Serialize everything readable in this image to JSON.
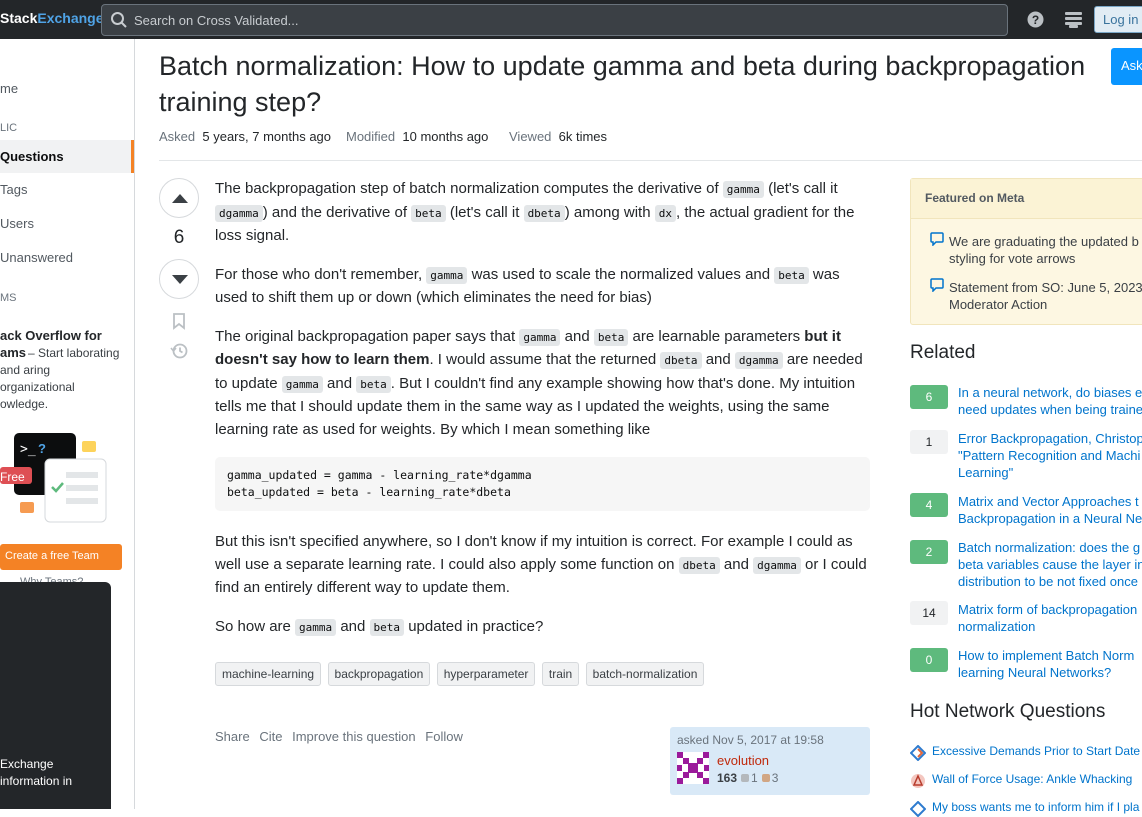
{
  "header": {
    "logo_stack": "Stack",
    "logo_exchange": "Exchange",
    "search_placeholder": "Search on Cross Validated...",
    "login_label": "Log in"
  },
  "leftnav": {
    "home": "me",
    "public_label": "LIC",
    "questions": "Questions",
    "tags": "Tags",
    "users": "Users",
    "unanswered": "Unanswered",
    "teams_label": "MS",
    "teams_title": "ack Overflow for ams",
    "teams_desc": "– Start laborating and aring organizational owledge.",
    "free_badge": "Free",
    "create_team": "Create a free Team",
    "why_teams": "Why Teams?",
    "panel_text": "Exchange information in"
  },
  "question": {
    "title": "Batch normalization: How to update gamma and beta during backpropagation training step?",
    "ask_label": "Ask",
    "asked_label": "Asked",
    "asked_value": "5 years, 7 months ago",
    "modified_label": "Modified",
    "modified_value": "10 months ago",
    "viewed_label": "Viewed",
    "viewed_value": "6k times",
    "score": "6",
    "p1a": "The backpropagation step of batch normalization computes the derivative of ",
    "c_gamma": "gamma",
    "p1b": " (let's call it ",
    "c_dgamma": "dgamma",
    "p1c": ") and the derivative of ",
    "c_beta": "beta",
    "p1d": " (let's call it ",
    "c_dbeta": "dbeta",
    "p1e": ") among with ",
    "c_dx": "dx",
    "p1f": ", the actual gradient for the loss signal.",
    "p2a": "For those who don't remember, ",
    "p2b": " was used to scale the normalized values and ",
    "p2c": " was used to shift them up or down (which eliminates the need for bias)",
    "p3a": "The original backpropagation paper says that ",
    "p3b": " and ",
    "p3c": " are learnable parameters ",
    "p3bold": "but it doesn't say how to learn them",
    "p3d": ". I would assume that the returned ",
    "p3e": " and ",
    "p3f": " are needed to update ",
    "p3g": " and ",
    "p3h": ". But I couldn't find any example showing how that's done. My intuition tells me that I should update them in the same way as I updated the weights, using the same learning rate as used for weights. By which I mean something like",
    "code_block": "gamma_updated = gamma - learning_rate*dgamma\nbeta_updated = beta - learning_rate*dbeta",
    "p4a": "But this isn't specified anywhere, so I don't know if my intuition is correct. For example I could as well use a separate learning rate. I could also apply some function on ",
    "p4b": " and ",
    "p4c": " or I could find an entirely different way to update them.",
    "p5a": "So how are ",
    "p5b": " and ",
    "p5c": " updated in practice?",
    "tags": [
      "machine-learning",
      "backpropagation",
      "hyperparameter",
      "train",
      "batch-normalization"
    ],
    "actions": [
      "Share",
      "Cite",
      "Improve this question",
      "Follow"
    ],
    "owner": {
      "asked_text": "asked Nov 5, 2017 at 19:58",
      "name": "evolution",
      "rep": "163",
      "silver": "1",
      "bronze": "3"
    }
  },
  "sidebar": {
    "featured_title": "Featured on Meta",
    "featured": [
      "We are graduating the updated b styling for vote arrows",
      "Statement from SO: June 5, 2023 Moderator Action"
    ],
    "related_title": "Related",
    "related": [
      {
        "score": "6",
        "accepted": true,
        "title": "In a neural network, do biases e need updates when being traine"
      },
      {
        "score": "1",
        "accepted": false,
        "title": "Error Backpropagation, Christop \"Pattern Recognition and Machi Learning\""
      },
      {
        "score": "4",
        "accepted": true,
        "title": "Matrix and Vector Approaches t Backpropagation in a Neural Ne"
      },
      {
        "score": "2",
        "accepted": true,
        "title": "Batch normalization: does the g beta variables cause the layer in distribution to be not fixed once"
      },
      {
        "score": "14",
        "accepted": false,
        "title": "Matrix form of backpropagation normalization"
      },
      {
        "score": "0",
        "accepted": true,
        "title": "How to implement Batch Norm learning Neural Networks?"
      }
    ],
    "hot_title": "Hot Network Questions",
    "hot": [
      "Excessive Demands Prior to Start Date",
      "Wall of Force Usage: Ankle Whacking",
      "My boss wants me to inform him if I pla"
    ]
  },
  "colors": {
    "accent": "#f48225",
    "link": "#0074cc",
    "accepted": "#5eba7d",
    "owner_name": "#c0290b"
  }
}
